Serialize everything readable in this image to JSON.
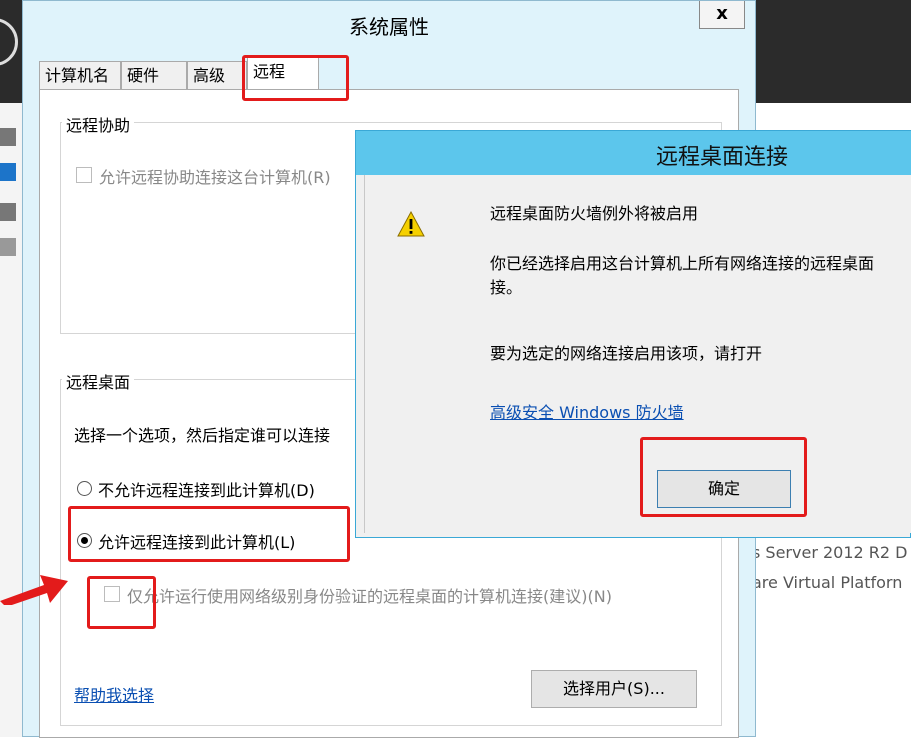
{
  "background": {
    "right_text_lines": [
      "s Server 2012 R2 D",
      "are Virtual Platforn"
    ]
  },
  "sys_dialog": {
    "title": "系统属性",
    "close_label": "x",
    "tabs": [
      {
        "label": "计算机名"
      },
      {
        "label": "硬件"
      },
      {
        "label": "高级"
      },
      {
        "label": "远程"
      }
    ],
    "remote_assistance": {
      "group_title": "远程协助",
      "allow_checkbox_label": "允许远程协助连接这台计算机(R)"
    },
    "remote_desktop": {
      "group_title": "远程桌面",
      "instruction": "选择一个选项，然后指定谁可以连接",
      "option_deny": "不允许远程连接到此计算机(D)",
      "option_allow": "允许远程连接到此计算机(L)",
      "nla_checkbox_label": "仅允许运行使用网络级别身份验证的远程桌面的计算机连接(建议)(N)",
      "help_link": "帮助我选择",
      "select_users_button": "选择用户(S)..."
    }
  },
  "rdp_dialog": {
    "title": "远程桌面连接",
    "heading": "远程桌面防火墙例外将被启用",
    "message_line1": "你已经选择启用这台计算机上所有网络连接的远程桌面",
    "message_line2": "接。",
    "instruction": "要为选定的网络连接启用该项，请打开",
    "firewall_link": "高级安全 Windows 防火墙",
    "ok_button": "确定"
  },
  "colors": {
    "highlight_red": "#e31b1b",
    "popup_title_blue": "#5cc6ec",
    "link_blue": "#0a4fb2"
  }
}
